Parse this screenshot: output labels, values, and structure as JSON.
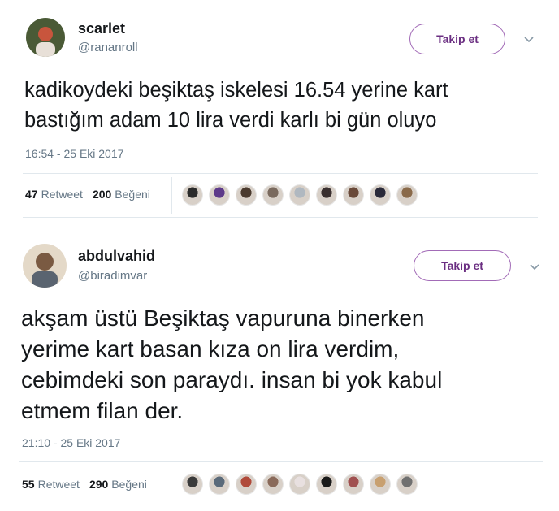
{
  "tweets": [
    {
      "display_name": "scarlet",
      "handle": "@rananroll",
      "follow_label": "Takip et",
      "text_lines": [
        "kadikoydeki beşiktaş iskelesi 16.54 yerine kart",
        "bastığım adam 10 lira verdi karlı bi gün oluyo"
      ],
      "timestamp": "16:54 - 25 Eki 2017",
      "retweet_count": "47",
      "retweet_label": "Retweet",
      "like_count": "200",
      "like_label": "Beğeni",
      "avatar_colors": [
        "#3d4a2c",
        "#c0392b"
      ],
      "liker_colors": [
        "#2b2b2b",
        "#5d3a8a",
        "#4a3a2e",
        "#7a6a5e",
        "#b0b8c0",
        "#3a3030",
        "#6a4a3a",
        "#2a2a3a",
        "#8a6a4a"
      ]
    },
    {
      "display_name": "abdulvahid",
      "handle": "@biradimvar",
      "follow_label": "Takip et",
      "text_lines": [
        "akşam üstü Beşiktaş vapuruna binerken",
        "yerime kart basan kıza on lira verdim,",
        "cebimdeki son paraydı. insan bi yok kabul",
        "etmem filan der."
      ],
      "timestamp": "21:10 - 25 Eki 2017",
      "retweet_count": "55",
      "retweet_label": "Retweet",
      "like_count": "290",
      "like_label": "Beğeni",
      "avatar_colors": [
        "#6b5a48",
        "#d9cbb5"
      ],
      "liker_colors": [
        "#3a3a3a",
        "#5a6a7a",
        "#b04a3a",
        "#8a6a5a",
        "#e8e0e0",
        "#1a1a1a",
        "#a05050",
        "#c8a070",
        "#707070"
      ]
    }
  ]
}
